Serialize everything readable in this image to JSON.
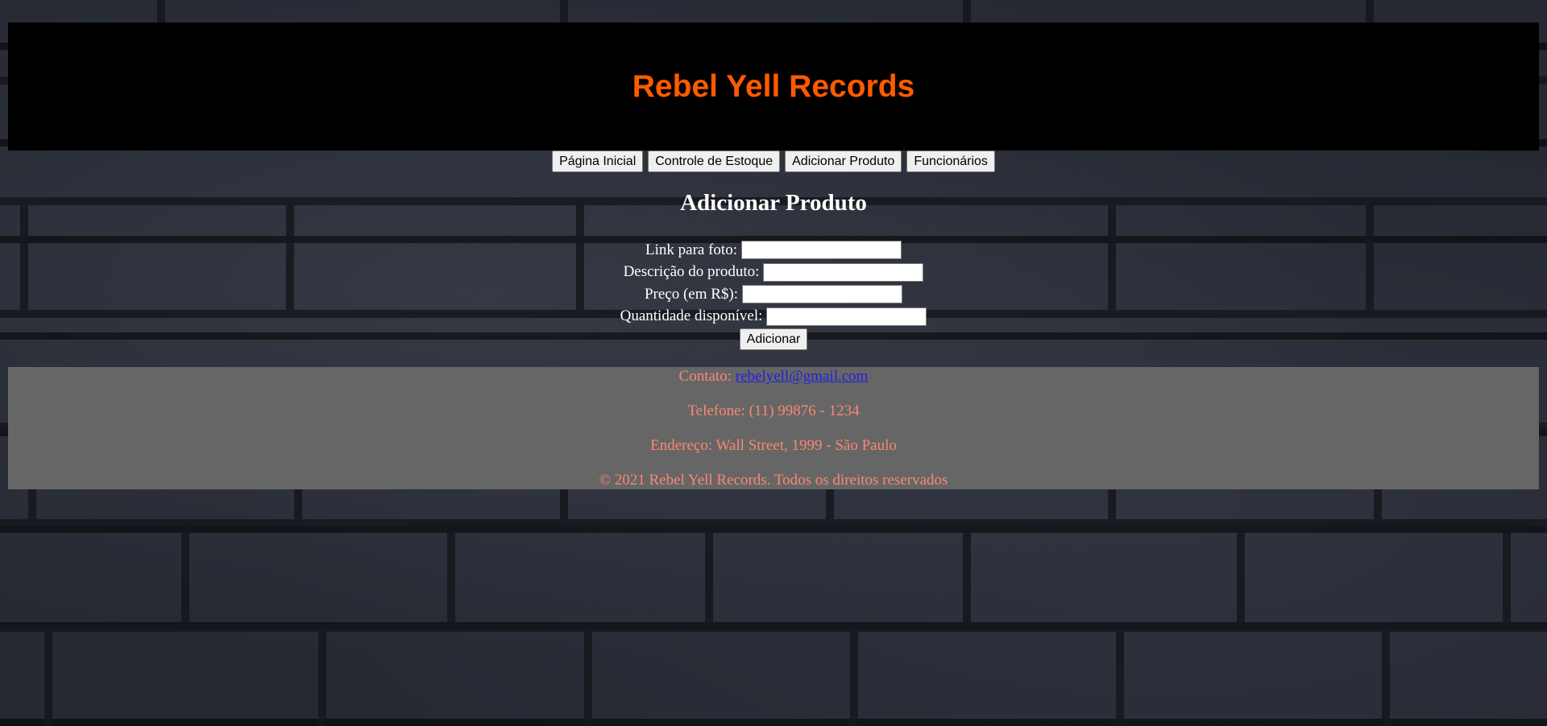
{
  "header": {
    "title": "Rebel Yell Records",
    "title_color": "#ff5a00",
    "background": "#000000"
  },
  "nav": {
    "items": [
      {
        "label": "Página Inicial"
      },
      {
        "label": "Controle de Estoque"
      },
      {
        "label": "Adicionar Produto"
      },
      {
        "label": "Funcionários"
      }
    ]
  },
  "main": {
    "title": "Adicionar Produto",
    "form": {
      "fields": [
        {
          "label": "Link para foto:",
          "value": ""
        },
        {
          "label": "Descrição do produto:",
          "value": ""
        },
        {
          "label": "Preço (em R$):",
          "value": ""
        },
        {
          "label": "Quantidade disponível:",
          "value": ""
        }
      ],
      "submit_label": "Adicionar"
    }
  },
  "footer": {
    "contact_label": "Contato:",
    "contact_email": "rebelyell@gmail.com",
    "phone": "Telefone: (11) 99876 - 1234",
    "address": "Endereço: Wall Street, 1999 - São Paulo",
    "copyright": "© 2021 Rebel Yell Records. Todos os direitos reservados",
    "background": "#666666",
    "text_color": "#fa8872"
  }
}
